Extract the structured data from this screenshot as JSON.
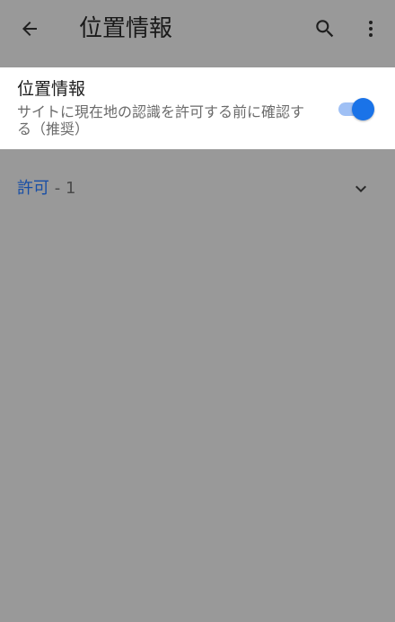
{
  "app_bar": {
    "title": "位置情報",
    "back_icon": "arrow-left-icon",
    "search_icon": "search-icon",
    "more_icon": "more-vert-icon"
  },
  "location_setting": {
    "title": "位置情報",
    "description": "サイトに現在地の認識を許可する前に確認する（推奨）",
    "enabled": true
  },
  "allowed_section": {
    "label": "許可",
    "count": "- 1",
    "expand_icon": "chevron-down-icon"
  },
  "colors": {
    "background": "#999999",
    "accent": "#1a73e8",
    "section_label": "#174ea6"
  }
}
